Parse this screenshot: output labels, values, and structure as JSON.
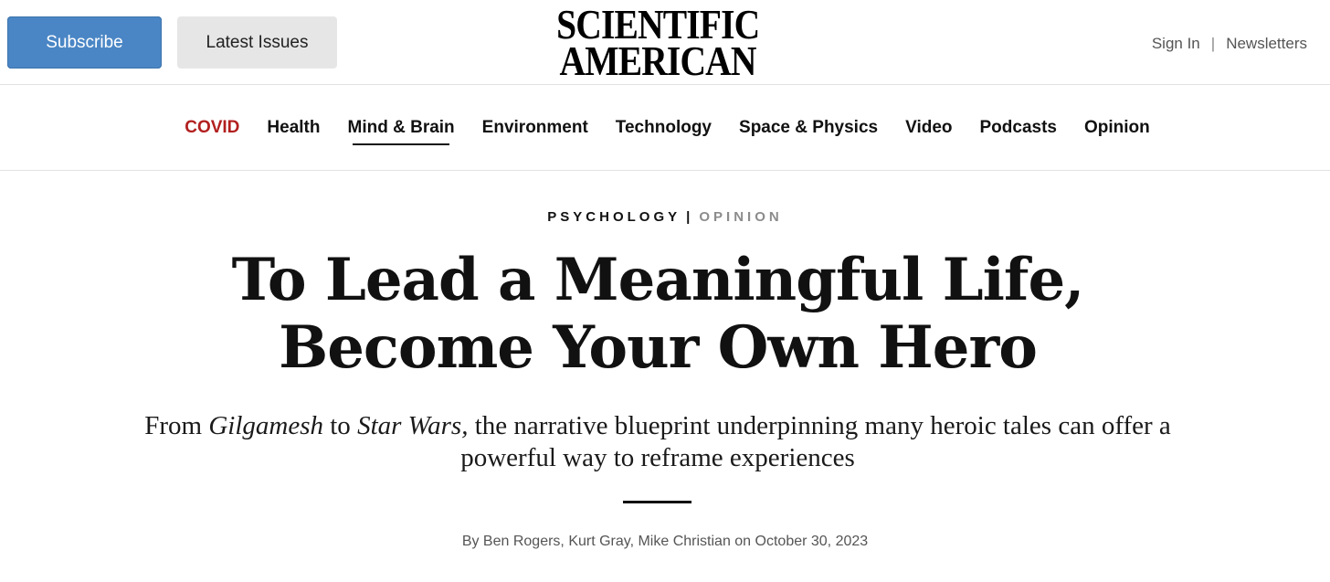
{
  "header": {
    "subscribe_label": "Subscribe",
    "latest_issues_label": "Latest Issues",
    "logo_line1": "SCIENTIFIC",
    "logo_line2": "AMERICAN",
    "sign_in_label": "Sign In",
    "separator": "|",
    "newsletters_label": "Newsletters"
  },
  "nav": {
    "items": [
      {
        "label": "COVID",
        "color": "#b21f1f"
      },
      {
        "label": "Health"
      },
      {
        "label": "Mind & Brain",
        "active": true
      },
      {
        "label": "Environment"
      },
      {
        "label": "Technology"
      },
      {
        "label": "Space & Physics"
      },
      {
        "label": "Video"
      },
      {
        "label": "Podcasts"
      },
      {
        "label": "Opinion"
      }
    ]
  },
  "article": {
    "category": "PSYCHOLOGY",
    "category_separator": "|",
    "type": "OPINION",
    "title_line1": "To Lead a Meaningful Life,",
    "title_line2": "Become Your Own Hero",
    "dek_prefix": "From ",
    "dek_em1": "Gilgamesh",
    "dek_mid": " to ",
    "dek_em2": "Star Wars,",
    "dek_suffix": " the narrative blueprint underpinning many heroic tales can offer a powerful way to reframe experiences",
    "byline": "By Ben Rogers, Kurt Gray, Mike Christian on October 30, 2023"
  },
  "colors": {
    "subscribe_bg": "#4a86c5",
    "latest_bg": "#e6e6e6",
    "covid": "#b21f1f",
    "opinion_kicker": "#8c8c8c"
  }
}
